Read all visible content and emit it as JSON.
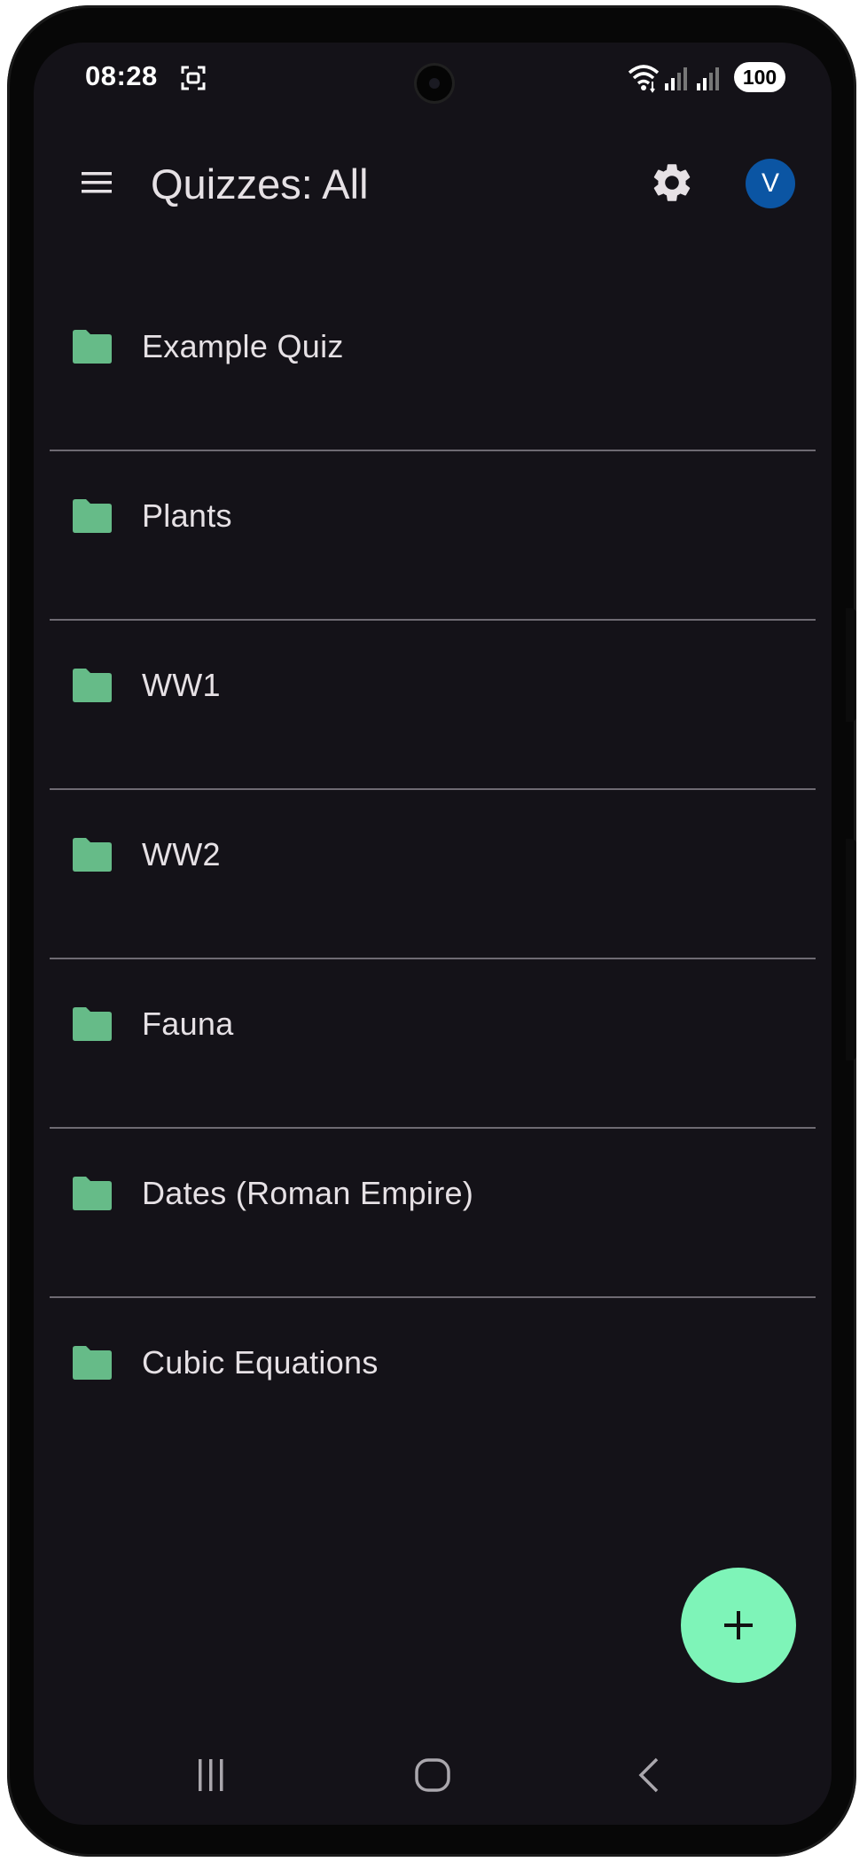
{
  "status_bar": {
    "time": "08:28",
    "battery": "100",
    "icons": [
      "screenshot-icon",
      "wifi-icon",
      "signal-icon",
      "signal-icon"
    ]
  },
  "app_bar": {
    "menu_icon": "menu-icon",
    "title": "Quizzes: All",
    "settings_icon": "gear-icon",
    "avatar_initial": "V",
    "avatar_color": "#0b55a3"
  },
  "quizzes": [
    {
      "label": "Example Quiz",
      "icon": "folder-icon"
    },
    {
      "label": "Plants",
      "icon": "folder-icon"
    },
    {
      "label": "WW1",
      "icon": "folder-icon"
    },
    {
      "label": "WW2",
      "icon": "folder-icon"
    },
    {
      "label": "Fauna",
      "icon": "folder-icon"
    },
    {
      "label": "Dates (Roman Empire)",
      "icon": "folder-icon"
    },
    {
      "label": "Cubic Equations",
      "icon": "folder-icon"
    }
  ],
  "fab": {
    "icon": "plus-icon",
    "color": "#7ef4b8"
  },
  "colors": {
    "background": "#141218",
    "folder": "#66bb88",
    "text": "#e6e1e5",
    "divider": "#6e6a72"
  },
  "nav_bar": {
    "items": [
      "recents-icon",
      "home-icon",
      "back-icon"
    ]
  }
}
